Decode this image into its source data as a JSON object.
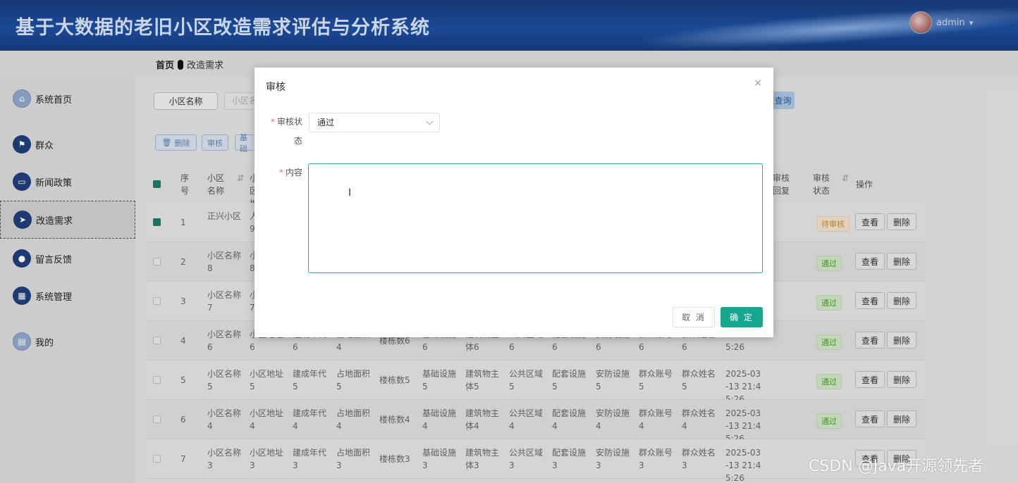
{
  "header": {
    "title": "基于大数据的老旧小区改造需求评估与分析系统",
    "username": "admin",
    "dropdown_icon": "▾"
  },
  "breadcrumb": {
    "home": "首页",
    "current": "改造需求"
  },
  "sidebar": {
    "items": [
      {
        "label": "系统首页",
        "icon": "home-icon",
        "glyph": "⌂"
      },
      {
        "label": "群众",
        "icon": "flag-icon",
        "glyph": "⚑"
      },
      {
        "label": "新闻政策",
        "icon": "monitor-icon",
        "glyph": "▭"
      },
      {
        "label": "改造需求",
        "icon": "send-icon",
        "glyph": "➤"
      },
      {
        "label": "留言反馈",
        "icon": "bulb-icon",
        "glyph": "●"
      },
      {
        "label": "系统管理",
        "icon": "grid-icon",
        "glyph": "▦"
      },
      {
        "label": "我的",
        "icon": "card-icon",
        "glyph": "▤"
      }
    ]
  },
  "search": {
    "label": "小区名称",
    "placeholder": "小区名",
    "query_label": "查询"
  },
  "toolbar": {
    "delete_label": "删除",
    "audit_label": "审核",
    "more_label": "基础"
  },
  "table": {
    "headers": [
      "序号",
      "小区名称",
      "小区地址",
      "审核回复",
      "审核状态",
      "操作"
    ],
    "rows": [
      {
        "index": "1",
        "name": "正兴小区",
        "addr": "人",
        "addr2": "9",
        "status": "待审核",
        "status_type": "pend",
        "checked": true
      },
      {
        "index": "2",
        "name": "小区名称8",
        "addr": "小",
        "addr2": "8",
        "status": "通过",
        "status_type": "pass",
        "checked": false
      },
      {
        "index": "3",
        "name": "小区名称7",
        "addr": "小",
        "addr2": "7",
        "status": "通过",
        "status_type": "pass",
        "checked": false
      },
      {
        "index": "4",
        "name": "小区名称6",
        "addr": "小区地址6",
        "year": "建成年代6",
        "area": "占地面积4",
        "bld": "楼栋数6",
        "infra": "基础设施6",
        "main": "建筑物主体6",
        "pub": "公共区域6",
        "equip": "配套设施6",
        "safety": "安防设施6",
        "acct": "群众账号6",
        "uname": "群众姓名6",
        "time": "13 21:45:26",
        "status": "通过",
        "status_type": "pass",
        "checked": false
      },
      {
        "index": "5",
        "name": "小区名称5",
        "addr": "小区地址5",
        "year": "建成年代5",
        "area": "占地面积5",
        "bld": "楼栋数5",
        "infra": "基础设施5",
        "main": "建筑物主体5",
        "pub": "公共区域5",
        "equip": "配套设施5",
        "safety": "安防设施5",
        "acct": "群众账号5",
        "uname": "群众姓名5",
        "time": "2025-03-13 21:45:26",
        "status": "通过",
        "status_type": "pass",
        "checked": false
      },
      {
        "index": "6",
        "name": "小区名称4",
        "addr": "小区地址4",
        "year": "建成年代4",
        "area": "占地面积4",
        "bld": "楼栋数4",
        "infra": "基础设施4",
        "main": "建筑物主体4",
        "pub": "公共区域4",
        "equip": "配套设施4",
        "safety": "安防设施4",
        "acct": "群众账号4",
        "uname": "群众姓名4",
        "time": "2025-03-13 21:45:26",
        "status": "通过",
        "status_type": "pass",
        "checked": false
      },
      {
        "index": "7",
        "name": "小区名称3",
        "addr": "小区地址3",
        "year": "建成年代3",
        "area": "占地面积3",
        "bld": "楼栋数3",
        "infra": "基础设施3",
        "main": "建筑物主体3",
        "pub": "公共区域3",
        "equip": "配套设施3",
        "safety": "安防设施3",
        "acct": "群众账号3",
        "uname": "群众姓名3",
        "time": "2025-03-13 21:45:26",
        "status": "",
        "status_type": "",
        "checked": false
      }
    ],
    "view_label": "查看",
    "delete_label": "删除"
  },
  "dialog": {
    "title": "审核",
    "close_icon": "×",
    "status_label_1": "审核状",
    "status_label_2": "态",
    "status_value": "通过",
    "content_label": "内容",
    "content_value": "",
    "cancel_label": "取 消",
    "confirm_label": "确 定"
  },
  "watermark": "CSDN @Java开源领先者",
  "colors": {
    "primary": "#17a68f",
    "header": "#1d4fa0",
    "required": "#f56c6c"
  }
}
